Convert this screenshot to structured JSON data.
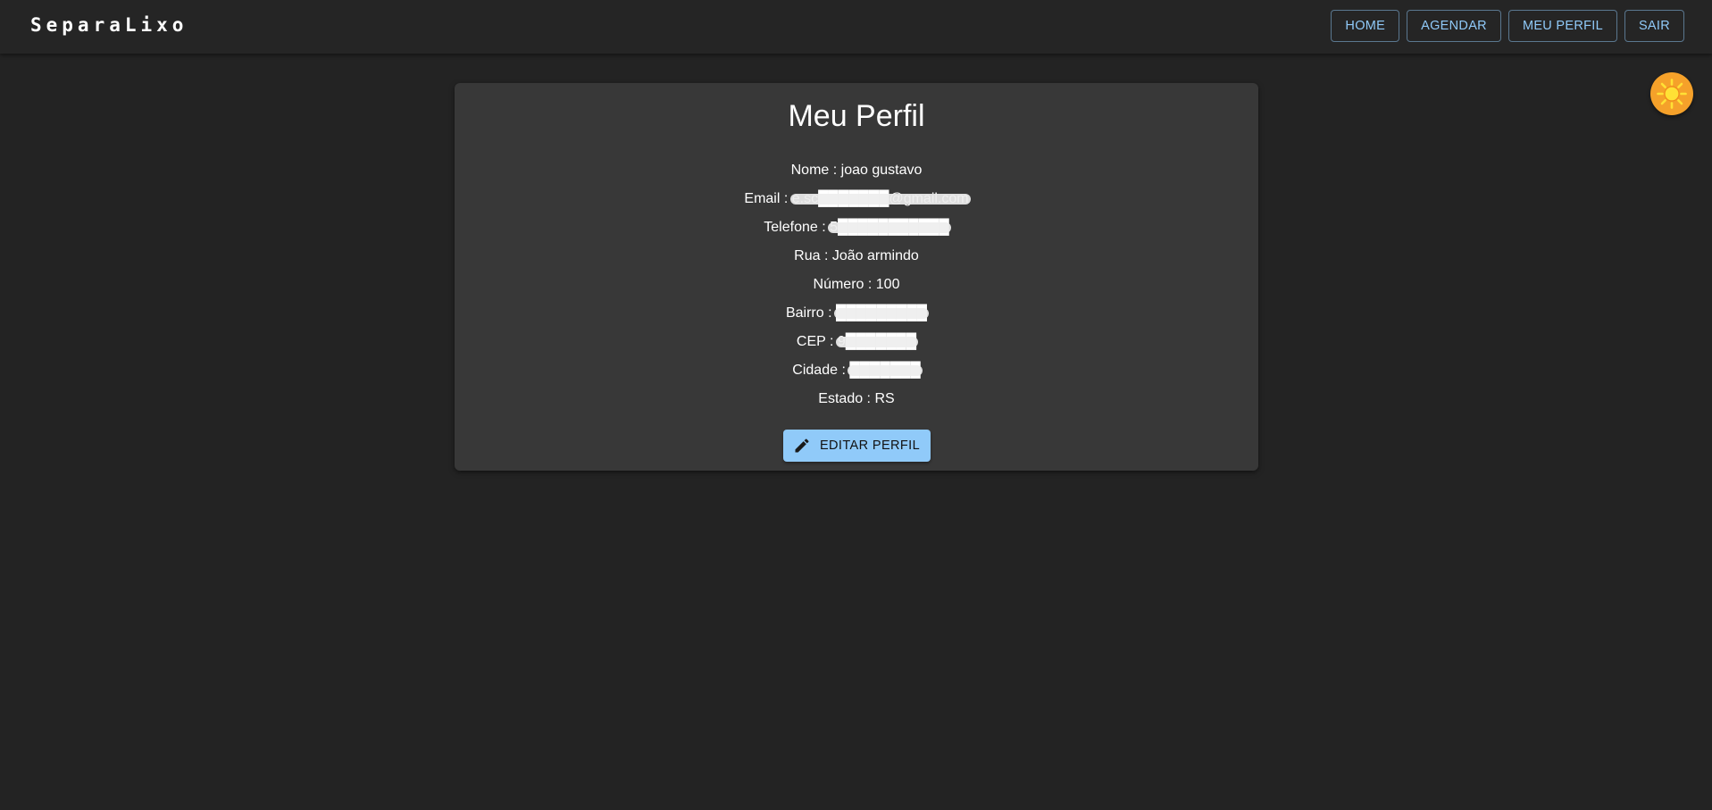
{
  "appbar": {
    "brand": "SeparaLixo",
    "nav": {
      "home": "HOME",
      "agendar": "AGENDAR",
      "meu_perfil": "MEU PERFIL",
      "sair": "SAIR"
    },
    "accent_color": "#90caf9"
  },
  "theme_toggle": {
    "icon": "sun-icon",
    "color": "#f5a12a"
  },
  "profile": {
    "title": "Meu Perfil",
    "nome_label": "Nome : ",
    "nome": "joao gustavo",
    "email_label": "Email : ",
    "email": "e.sc███████@gmail.com",
    "telefone_label": "Telefone : ",
    "telefone": "5███████████",
    "rua_label": "Rua : ",
    "rua": "João armindo",
    "numero_label": "Número : ",
    "numero": "100",
    "bairro_label": "Bairro : ",
    "bairro": "█████████",
    "cep_label": "CEP : ",
    "cep": "9███████",
    "cidade_label": "Cidade : ",
    "cidade": "███████",
    "estado_label": "Estado : ",
    "estado": "RS",
    "edit_button": {
      "label": "EDITAR PERFIL",
      "icon": "pencil-icon"
    }
  },
  "colors": {
    "background": "#232323",
    "card": "#383838",
    "primary_button": "#90caf9"
  }
}
